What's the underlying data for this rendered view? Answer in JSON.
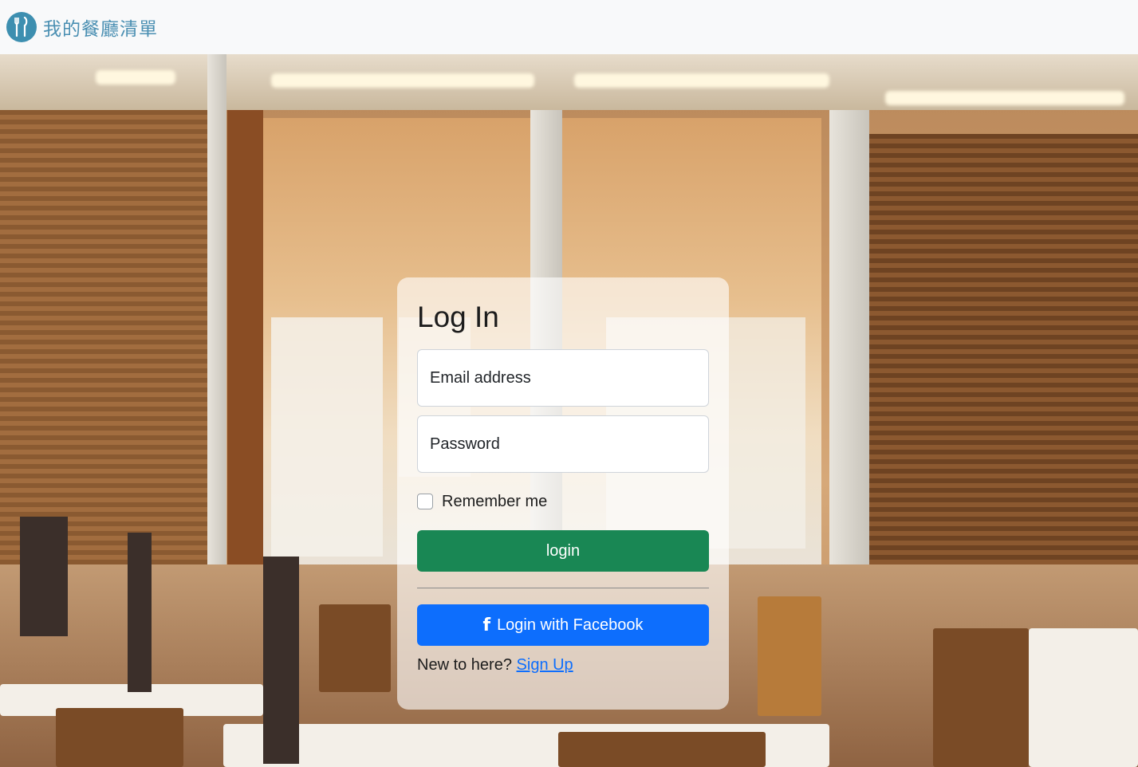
{
  "navbar": {
    "brand_text": "我的餐廳清單",
    "logo_icon": "fork-knife-icon",
    "brand_color": "#4a8fb2"
  },
  "login_card": {
    "title": "Log In",
    "email_placeholder": "Email address",
    "password_placeholder": "Password",
    "remember_label": "Remember me",
    "login_button": "login",
    "facebook_button": "Login with Facebook",
    "facebook_icon": "facebook-icon",
    "signup_prompt": "New to here?",
    "signup_link": "Sign Up"
  },
  "colors": {
    "login_button": "#198754",
    "facebook_button": "#0d6efd",
    "link": "#0d6efd"
  }
}
